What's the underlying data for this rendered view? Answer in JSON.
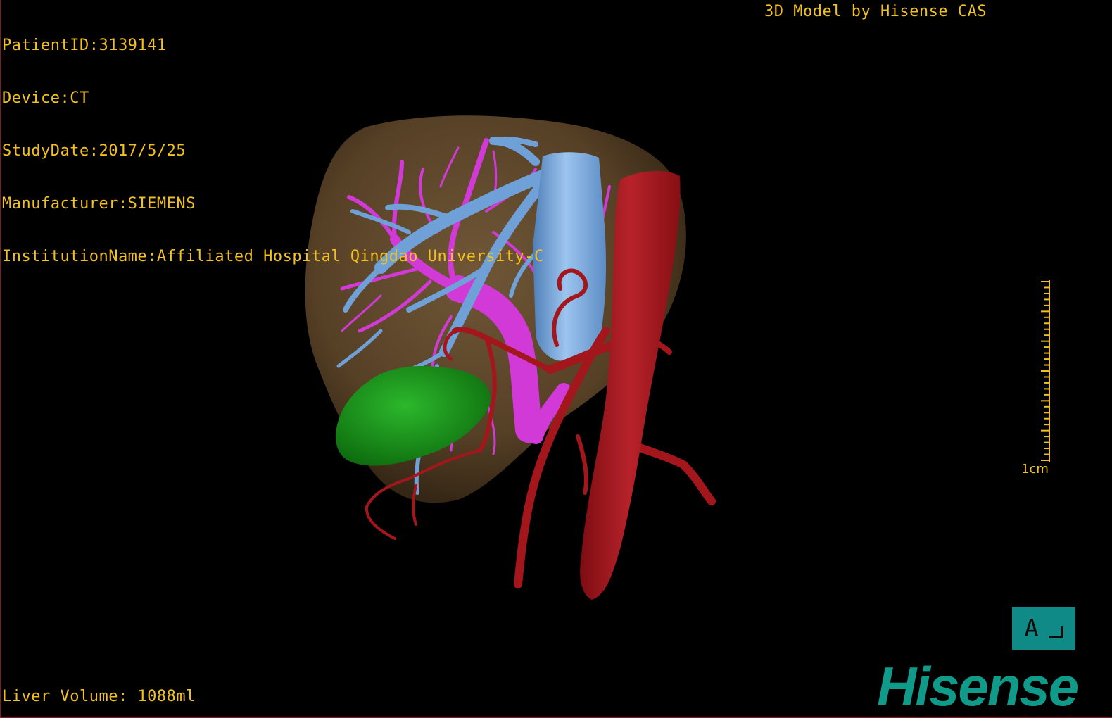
{
  "patient_info": {
    "patient_id": "PatientID:3139141",
    "device": "Device:CT",
    "study_date": "StudyDate:2017/5/25",
    "manufacturer": "Manufacturer:SIEMENS",
    "institution": "InstitutionName:Affiliated Hospital Qingdao University-C"
  },
  "model_credit": "3D Model by Hisense CAS",
  "liver_volume": "Liver Volume: 1088ml",
  "scale_bar": {
    "label": "1cm"
  },
  "orientation": {
    "letter": "A"
  },
  "brand_logo": "Hisense",
  "colors": {
    "overlay_text": "#f2c11c",
    "liver": "#6b5234",
    "hepatic_vein": "#6fa0d8",
    "portal_vein": "#d23ad8",
    "artery": "#a3161c",
    "lesion": "#1e9a1e",
    "orientation_box": "#0f8a86",
    "brand": "#109a8a"
  }
}
